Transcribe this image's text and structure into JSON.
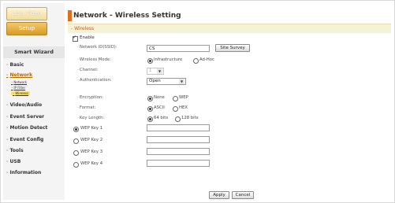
{
  "sidebar": {
    "live_view_label": "Live Video",
    "setup_label": "Setup",
    "smart_wizard_label": "Smart Wizard",
    "items": [
      {
        "label": "Basic"
      },
      {
        "label": "Network",
        "active": true
      },
      {
        "label": "Video/Audio"
      },
      {
        "label": "Event Server"
      },
      {
        "label": "Motion Detect"
      },
      {
        "label": "Event Config"
      },
      {
        "label": "Tools"
      },
      {
        "label": "USB"
      },
      {
        "label": "Information"
      }
    ],
    "network_sub": [
      {
        "label": "Network"
      },
      {
        "label": "IP Filter"
      },
      {
        "label": "Wireless",
        "active": true
      }
    ]
  },
  "page": {
    "title": "Network - Wireless Setting",
    "section": "Wireless"
  },
  "form": {
    "enable_label": "Enable",
    "enable_checked": true,
    "ssid_label": "Network ID(SSID):",
    "ssid_value": "CS",
    "site_survey_label": "Site Survey",
    "wireless_mode_label": "Wireless Mode:",
    "mode_options": [
      "Infrastructure",
      "Ad-Hoc"
    ],
    "mode_selected": "Infrastructure",
    "channel_label": "Channel:",
    "channel_value": "1",
    "authentication_label": "Authentication:",
    "authentication_value": "Open",
    "encryption_label": "Encryption:",
    "encryption_options": [
      "None",
      "WEP"
    ],
    "encryption_selected": "None",
    "format_label": "Format:",
    "format_options": [
      "ASCII",
      "HEX"
    ],
    "format_selected": "ASCII",
    "key_length_label": "Key Length:",
    "key_length_options": [
      "64 bits",
      "128 bits"
    ],
    "key_length_selected": "64 bits",
    "wep_keys": [
      {
        "label": "WEP Key 1",
        "selected": true,
        "value": ""
      },
      {
        "label": "WEP Key 2",
        "selected": false,
        "value": ""
      },
      {
        "label": "WEP Key 3",
        "selected": false,
        "value": ""
      },
      {
        "label": "WEP Key 4",
        "selected": false,
        "value": ""
      }
    ]
  },
  "actions": {
    "apply_label": "Apply",
    "cancel_label": "Cancel"
  },
  "colors": {
    "accent": "#e0701c",
    "section_bg": "#f6f2d8",
    "setup_tab": "#d99a24"
  }
}
